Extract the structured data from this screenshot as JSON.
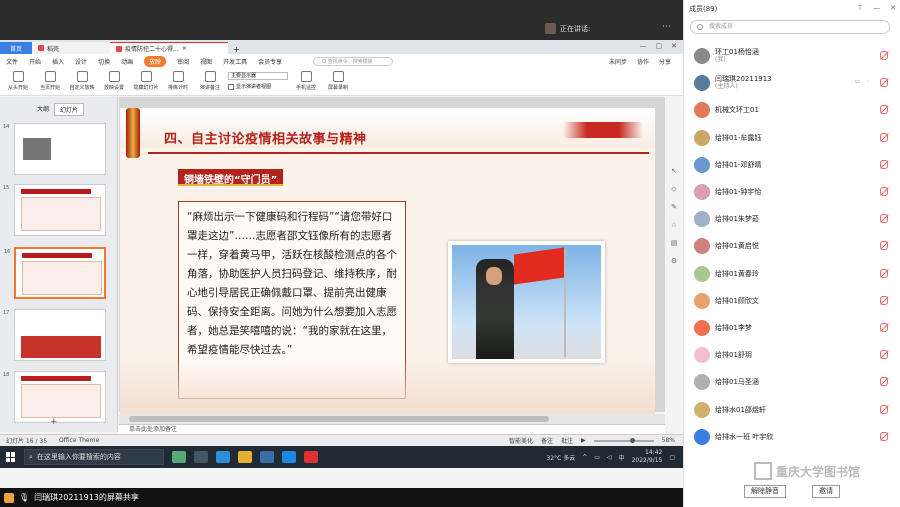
{
  "meeting": {
    "share_status": "正在讲话:",
    "share_user": "闫瑞琪20211913的屏幕共享"
  },
  "wps": {
    "tabs": [
      {
        "label": "首页"
      },
      {
        "label": "稻壳"
      },
      {
        "label": "疫情防控二十心得..."
      }
    ],
    "menu": [
      "文件",
      "开始",
      "插入",
      "设计",
      "切换",
      "动画",
      "放映",
      "审阅",
      "视图",
      "开发工具",
      "会员专享"
    ],
    "menu_active": "放映",
    "menu_search": "Q 查找命令、搜索模板",
    "menu_right": [
      "未同步",
      "协作",
      "分享"
    ],
    "ribbon": [
      "从头开始",
      "当页开始",
      "自定义放映",
      "放映设置",
      "隐藏幻灯片",
      "排练计时",
      "演讲备注",
      "手机遥控",
      "屏幕录制"
    ],
    "ribbon_select": "主要显示器",
    "ribbon_check": "显示演讲者视图",
    "left_tabs": [
      "大纲",
      "幻灯片"
    ],
    "slide_numbers": [
      "14",
      "15",
      "16",
      "17",
      "18"
    ],
    "note": "单击此处添加备注",
    "status_left": [
      "幻灯片 16 / 35",
      "Office Theme"
    ],
    "status_right": [
      "智能美化",
      "备注",
      "批注",
      "58%"
    ]
  },
  "slide": {
    "title": "四、自主讨论疫情相关故事与精神",
    "subtitle": "铜墙铁壁的“守门员”",
    "story": "“麻烦出示一下健康码和行程码”“请您带好口罩走这边”……志愿者邵文钰像所有的志愿者一样，穿着黄马甲，活跃在核酸检测点的各个角落，协助医护人员扫码登记、维持秩序，耐心地引导居民正确佩戴口罩、提前亮出健康码、保持安全距离。问她为什么想要加入志愿者，她总是笑嘻嘻的说：“我的家就在这里，希望疫情能尽快过去。”"
  },
  "taskbar": {
    "search_placeholder": "在这里输入你要搜索的内容",
    "weather": "32°C 多云",
    "time": "14:42",
    "date": "2022/9/15",
    "lang": "中"
  },
  "panel": {
    "title": "成员(89)",
    "search_placeholder": "搜索成员",
    "members": [
      {
        "name": "环工01杨怡涵",
        "role": "(我)",
        "color": "#8a8a8a"
      },
      {
        "name": "闫瑞琪20211913",
        "role": "(主持人)",
        "color": "#5a7a9a"
      },
      {
        "name": "机械文环工01",
        "role": "",
        "color": "#e07a5a"
      },
      {
        "name": "给排01-牟露钰",
        "role": "",
        "color": "#c9a86a"
      },
      {
        "name": "给排01-邓舒晴",
        "role": "",
        "color": "#6a9ad0"
      },
      {
        "name": "给排01-钟宇怡",
        "role": "",
        "color": "#d8a0b0"
      },
      {
        "name": "给排01朱梦茹",
        "role": "",
        "color": "#a0b0c8"
      },
      {
        "name": "给排01黄启悦",
        "role": "",
        "color": "#d08080"
      },
      {
        "name": "给排01黄春玲",
        "role": "",
        "color": "#a8c890"
      },
      {
        "name": "给排01顾欣文",
        "role": "",
        "color": "#e8a070"
      },
      {
        "name": "给排01李梦",
        "role": "",
        "color": "#f07050"
      },
      {
        "name": "给排01舒玥",
        "role": "",
        "color": "#f0c0d0"
      },
      {
        "name": "给排01马圣涵",
        "role": "",
        "color": "#b0b0b0"
      },
      {
        "name": "给排水01邵煜轩",
        "role": "",
        "color": "#d0b070"
      },
      {
        "name": "给排水一班 叶宇欣",
        "role": "",
        "color": "#3a7ee4"
      }
    ],
    "watermark": "重庆大学图书馆",
    "btn_unmute": "解除静音",
    "btn_invite": "邀请"
  }
}
